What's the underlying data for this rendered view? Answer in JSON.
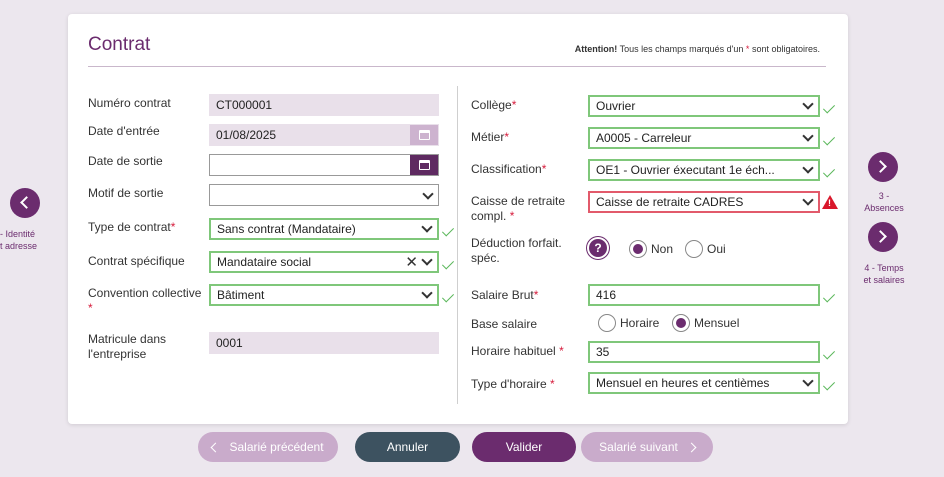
{
  "card": {
    "title": "Contrat",
    "notice_bold": "Attention!",
    "notice_text": "Tous les champs marqués d'un",
    "notice_star": "*",
    "notice_end": "sont obligatoires."
  },
  "left": {
    "numero_label": "Numéro contrat",
    "numero_value": "CT000001",
    "date_entree_label": "Date d'entrée",
    "date_entree_value": "01/08/2025",
    "date_sortie_label": "Date de sortie",
    "date_sortie_value": "",
    "motif_label": "Motif de sortie",
    "motif_value": "",
    "type_contrat_label": "Type de contrat",
    "type_contrat_value": "Sans contrat (Mandataire)",
    "contrat_specifique_label": "Contrat spécifique",
    "contrat_specifique_value": "Mandataire social",
    "convention_label": "Convention collective",
    "convention_value": "Bâtiment",
    "matricule_label": "Matricule dans l'entreprise",
    "matricule_value": "0001"
  },
  "right": {
    "college_label": "Collège",
    "college_value": "Ouvrier",
    "metier_label": "Métier",
    "metier_value": "A0005 - Carreleur",
    "classification_label": "Classification",
    "classification_value": "OE1 - Ouvrier éxecutant 1e éch...",
    "caisse_label": "Caisse de retraite compl.",
    "caisse_value": "Caisse de retraite CADRES",
    "deduction_label": "Déduction forfait. spéc.",
    "deduction_options": [
      "Non",
      "Oui"
    ],
    "deduction_selected": "Non",
    "salaire_label": "Salaire Brut",
    "salaire_value": "416",
    "base_label": "Base salaire",
    "base_options": [
      "Horaire",
      "Mensuel"
    ],
    "base_selected": "Mensuel",
    "horaire_label": "Horaire habituel",
    "horaire_value": "35",
    "type_horaire_label": "Type d'horaire",
    "type_horaire_value": "Mensuel en heures et centièmes"
  },
  "required_star": "*",
  "side_nav": {
    "left_label_1": "- Identité",
    "left_label_2": "t adresse",
    "right_label_1": "3 -",
    "right_label_2": "Absences",
    "right_label_3": "4 - Temps",
    "right_label_4": "et salaires"
  },
  "buttons": {
    "prev": "Salarié précédent",
    "cancel": "Annuler",
    "validate": "Valider",
    "next": "Salarié suivant"
  },
  "colors": {
    "brand": "#6b2c6e",
    "valid": "#7fc77a",
    "error": "#e25a6b",
    "readonly": "#e9e0ea"
  }
}
